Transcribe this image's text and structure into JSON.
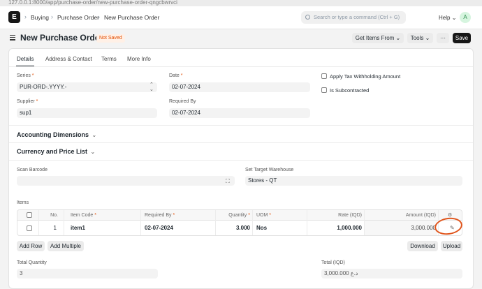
{
  "browser": {
    "url": "127.0.0.1:8000/app/purchase-order/new-purchase-order-qngcbwrvci"
  },
  "navbar": {
    "logo": "E",
    "breadcrumbs": [
      "Buying",
      "Purchase Order",
      "New Purchase Order"
    ],
    "search_placeholder": "Search or type a command (Ctrl + G)",
    "help_label": "Help",
    "avatar_initial": "A"
  },
  "page": {
    "title": "New Purchase Order",
    "status": "Not Saved",
    "get_items_label": "Get Items From",
    "tools_label": "Tools",
    "more_label": "···",
    "save_label": "Save"
  },
  "tabs": [
    "Details",
    "Address & Contact",
    "Terms",
    "More Info"
  ],
  "form": {
    "series": {
      "label": "Series",
      "value": "PUR-ORD-.YYYY.-"
    },
    "date": {
      "label": "Date",
      "value": "02-07-2024"
    },
    "supplier": {
      "label": "Supplier",
      "value": "sup1"
    },
    "required_by": {
      "label": "Required By",
      "value": "02-07-2024"
    },
    "apply_tax": "Apply Tax Withholding Amount",
    "is_subcontracted": "Is Subcontracted"
  },
  "sections": {
    "accounting": "Accounting Dimensions",
    "currency": "Currency and Price List"
  },
  "scan_barcode": {
    "label": "Scan Barcode",
    "value": ""
  },
  "target_warehouse": {
    "label": "Set Target Warehouse",
    "value": "Stores - QT"
  },
  "items": {
    "label": "Items",
    "columns": {
      "no": "No.",
      "item_code": "Item Code",
      "required_by": "Required By",
      "quantity": "Quantity",
      "uom": "UOM",
      "rate": "Rate (IQD)",
      "amount": "Amount (IQD)"
    },
    "rows": [
      {
        "no": "1",
        "item_code": "item1",
        "required_by": "02-07-2024",
        "quantity": "3.000",
        "uom": "Nos",
        "rate": "1,000.000",
        "amount": "3,000.000"
      }
    ],
    "add_row_label": "Add Row",
    "add_multiple_label": "Add Multiple",
    "download_label": "Download",
    "upload_label": "Upload"
  },
  "totals": {
    "total_quantity": {
      "label": "Total Quantity",
      "value": "3"
    },
    "total": {
      "label": "Total (IQD)",
      "value": "3,000.000 د.ع"
    }
  },
  "colors": {
    "accent": "#171717",
    "status": "#e24c00",
    "annotation": "#e0541b"
  }
}
